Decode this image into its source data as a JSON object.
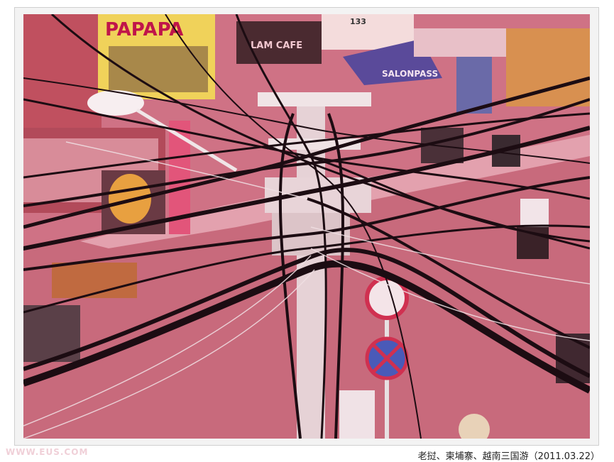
{
  "photo": {
    "signs": {
      "papa": "PAPAPA",
      "lam_cafe": "LAM CAFE",
      "salon": "SALONPASS",
      "number": "133"
    },
    "colors": {
      "tint": "#d47a8a",
      "road": "#c96a7c",
      "wires": "#1c0c12"
    }
  },
  "caption": "老挝、柬埔寨、越南三国游（2011.03.22）",
  "watermark": "WWW.EUS.COM"
}
